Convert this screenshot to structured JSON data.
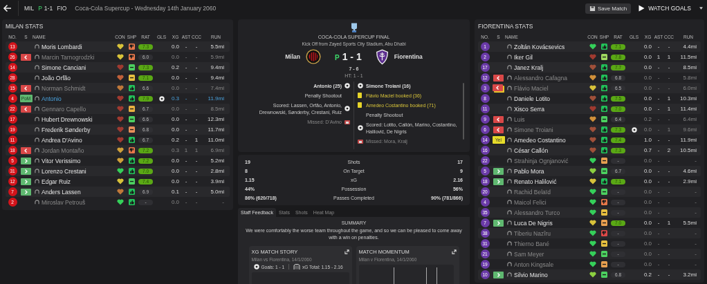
{
  "header": {
    "home": "MIL",
    "penalty_mark": "P",
    "score": "1-1",
    "away": "FIO",
    "title": "Coca-Cola Supercup - Wednesday 14th January 2060"
  },
  "actions": [
    {
      "kind": "save",
      "label": "Save Match"
    },
    {
      "kind": "watch",
      "label": "WATCH GOALS"
    }
  ],
  "teams": [
    {
      "title": "MILAN STATS",
      "color": "#d3141b",
      "columns": [
        "NO.",
        "S",
        "NAME",
        "CON",
        "SHP",
        "RAT",
        "GLS",
        "XG",
        "AST",
        "CCC",
        "RUN"
      ],
      "players": [
        {
          "no": "13",
          "name": "Moris Lombardi",
          "con": {
            "color": "#d8c23a"
          },
          "shp": {
            "kind": "down",
            "color": "#e8784a"
          },
          "rat": "7.3",
          "rat_high": true,
          "goal": false,
          "xg": "0.0",
          "ast": "-",
          "ccc": "-",
          "run": "5.5mi",
          "dimmed": false,
          "highlighted": false
        },
        {
          "no": "26",
          "sub": {
            "kind": "off"
          },
          "name": "Marcin Tarnogrodzki",
          "con": {
            "color": "#d8c23a"
          },
          "shp": {
            "kind": "down",
            "color": "#e8784a"
          },
          "rat": "6.0",
          "rat_high": false,
          "goal": false,
          "xg": "0.0",
          "ast": "-",
          "ccc": "-",
          "run": "5.9mi",
          "dimmed": true,
          "highlighted": false
        },
        {
          "no": "14",
          "name": "Simone Canciani",
          "con": {
            "color": "#a03a30"
          },
          "shp": {
            "kind": "level",
            "color": "#4cd060"
          },
          "rat": "7.3",
          "rat_high": true,
          "goal": false,
          "xg": "0.2",
          "ast": "-",
          "ccc": "-",
          "run": "9.4mi",
          "dimmed": false,
          "highlighted": false
        },
        {
          "no": "28",
          "name": "João Orfão",
          "con": {
            "color": "#c0603a"
          },
          "shp": {
            "kind": "level",
            "color": "#e8c040"
          },
          "rat": "7.1",
          "rat_high": true,
          "goal": false,
          "xg": "0.0",
          "ast": "-",
          "ccc": "-",
          "run": "9.4mi",
          "dimmed": false,
          "highlighted": false
        },
        {
          "no": "15",
          "sub": {
            "kind": "off"
          },
          "name": "Norman Schmidt",
          "con": {
            "color": "#c0783a"
          },
          "shp": {
            "kind": "up",
            "color": "#22c25a"
          },
          "rat": "6.6",
          "rat_high": false,
          "goal": false,
          "xg": "0.0",
          "ast": "-",
          "ccc": "-",
          "run": "7.4mi",
          "dimmed": true,
          "highlighted": false
        },
        {
          "no": "4",
          "sub": {
            "kind": "pom",
            "label": "PoM"
          },
          "name": "Antonio",
          "con": {
            "color": "#a03a30"
          },
          "shp": {
            "kind": "up",
            "color": "#22c25a"
          },
          "rat": "7.9",
          "rat_high": true,
          "goal": true,
          "xg": "0.3",
          "ast": "-",
          "ccc": "-",
          "run": "11.9mi",
          "dimmed": false,
          "highlighted": true
        },
        {
          "no": "22",
          "sub": {
            "kind": "off"
          },
          "name": "Gennaro Capello",
          "con": {
            "color": "#a03a30"
          },
          "shp": {
            "kind": "level",
            "color": "#e8b040"
          },
          "rat": "6.7",
          "rat_high": false,
          "goal": false,
          "xg": "0.0",
          "ast": "-",
          "ccc": "-",
          "run": "8.5mi",
          "dimmed": true,
          "highlighted": false
        },
        {
          "no": "17",
          "name": "Hubert Drewnowski",
          "con": {
            "color": "#a03a30"
          },
          "shp": {
            "kind": "level",
            "color": "#4cd060"
          },
          "rat": "6.6",
          "rat_high": false,
          "goal": false,
          "xg": "0.0",
          "ast": "-",
          "ccc": "-",
          "run": "12.3mi",
          "dimmed": false,
          "highlighted": false
        },
        {
          "no": "19",
          "name": "Frederik Sønderby",
          "con": {
            "color": "#a03a30"
          },
          "shp": {
            "kind": "level",
            "color": "#e8905a"
          },
          "rat": "6.8",
          "rat_high": false,
          "goal": false,
          "xg": "0.0",
          "ast": "-",
          "ccc": "-",
          "run": "11.7mi",
          "dimmed": false,
          "highlighted": false
        },
        {
          "no": "11",
          "name": "Andrea D'Avino",
          "con": {
            "color": "#a03a30"
          },
          "shp": {
            "kind": "up",
            "color": "#22c25a"
          },
          "rat": "6.7",
          "rat_high": false,
          "goal": false,
          "xg": "0.2",
          "ast": "-",
          "ccc": "1",
          "run": "11.0mi",
          "dimmed": false,
          "highlighted": false
        },
        {
          "no": "18",
          "sub": {
            "kind": "off"
          },
          "name": "Jordan Montaño",
          "con": {
            "color": "#d0a03a"
          },
          "shp": {
            "kind": "down",
            "color": "#e8784a"
          },
          "rat": "7.2",
          "rat_high": true,
          "goal": false,
          "xg": "0.3",
          "ast": "1",
          "ccc": "1",
          "run": "6.9mi",
          "dimmed": true,
          "highlighted": false
        },
        {
          "no": "5",
          "sub": {
            "kind": "on"
          },
          "name": "Vitor Verissimo",
          "con": {
            "color": "#d0a03a"
          },
          "shp": {
            "kind": "up",
            "color": "#22c25a"
          },
          "rat": "7.2",
          "rat_high": true,
          "goal": false,
          "xg": "0.0",
          "ast": "-",
          "ccc": "-",
          "run": "5.2mi",
          "dimmed": false,
          "highlighted": false
        },
        {
          "no": "31",
          "sub": {
            "kind": "on"
          },
          "name": "Lorenzo Crestani",
          "con": {
            "color": "#35d05a"
          },
          "shp": {
            "kind": "up",
            "color": "#22c25a"
          },
          "rat": "7.0",
          "rat_high": true,
          "goal": false,
          "xg": "0.0",
          "ast": "-",
          "ccc": "-",
          "run": "2.8mi",
          "dimmed": false,
          "highlighted": false
        },
        {
          "no": "12",
          "sub": {
            "kind": "on"
          },
          "name": "Edgar Ruiz",
          "con": {
            "color": "#d8c23a"
          },
          "shp": {
            "kind": "level",
            "color": "#4cd060"
          },
          "rat": "7.4",
          "rat_high": true,
          "goal": false,
          "xg": "0.0",
          "ast": "-",
          "ccc": "-",
          "run": "3.9mi",
          "dimmed": false,
          "highlighted": false
        },
        {
          "no": "7",
          "sub": {
            "kind": "on"
          },
          "name": "Anders Lassen",
          "con": {
            "color": "#c0783a"
          },
          "shp": {
            "kind": "up",
            "color": "#22c25a"
          },
          "rat": "6.9",
          "rat_high": false,
          "goal": false,
          "xg": "0.1",
          "ast": "-",
          "ccc": "-",
          "run": "5.0mi",
          "dimmed": false,
          "highlighted": false
        },
        {
          "no": "2",
          "name": "Miroslav Petrouš",
          "con": {
            "color": "#35d05a"
          },
          "shp": {
            "kind": "up",
            "color": "#22c25a"
          },
          "rat": "-",
          "rat_high": false,
          "goal": false,
          "xg": "0.0",
          "ast": "-",
          "ccc": "-",
          "run": "-",
          "dimmed": true,
          "highlighted": false
        }
      ]
    },
    {
      "title": "FIORENTINA STATS",
      "color": "#6a3aa8",
      "columns": [
        "NO.",
        "S",
        "NAME",
        "CON",
        "SHP",
        "RAT",
        "GLS",
        "XG",
        "AST",
        "CCC",
        "RUN"
      ],
      "players": [
        {
          "no": "1",
          "name": "Zoltán Kovácsevics",
          "con": {
            "color": "#35d05a"
          },
          "shp": {
            "kind": "up",
            "color": "#22c25a"
          },
          "rat": "7.1",
          "rat_high": true,
          "goal": false,
          "xg": "0.0",
          "ast": "-",
          "ccc": "-",
          "run": "4.4mi",
          "dimmed": false,
          "highlighted": false
        },
        {
          "no": "2",
          "name": "Iker Gil",
          "con": {
            "color": "#a03a30"
          },
          "shp": {
            "kind": "level",
            "color": "#a0d860"
          },
          "rat": "7.8",
          "rat_high": true,
          "goal": false,
          "xg": "0.0",
          "ast": "1",
          "ccc": "1",
          "run": "11.5mi",
          "dimmed": false,
          "highlighted": false
        },
        {
          "no": "17",
          "name": "Janez Kralj",
          "con": {
            "color": "#a0503a"
          },
          "shp": {
            "kind": "up",
            "color": "#22c25a"
          },
          "rat": "7.7",
          "rat_high": true,
          "goal": false,
          "xg": "0.0",
          "ast": "-",
          "ccc": "-",
          "run": "8.5mi",
          "dimmed": false,
          "highlighted": false
        },
        {
          "no": "12",
          "sub": {
            "kind": "off"
          },
          "name": "Alessandro Cafagna",
          "con": {
            "color": "#d0903a"
          },
          "shp": {
            "kind": "up",
            "color": "#22c25a"
          },
          "rat": "6.8",
          "rat_high": false,
          "goal": false,
          "xg": "0.0",
          "ast": "-",
          "ccc": "-",
          "run": "5.8mi",
          "dimmed": true,
          "highlighted": false
        },
        {
          "no": "3",
          "sub": {
            "kind": "off_booked"
          },
          "name": "Flávio Maciel",
          "con": {
            "color": "#d8c23a"
          },
          "shp": {
            "kind": "up",
            "color": "#22c25a"
          },
          "rat": "6.5",
          "rat_high": false,
          "goal": false,
          "xg": "0.0",
          "ast": "-",
          "ccc": "-",
          "run": "6.0mi",
          "dimmed": true,
          "highlighted": false
        },
        {
          "no": "8",
          "name": "Daniele Lotito",
          "con": {
            "color": "#a0503a"
          },
          "shp": {
            "kind": "up",
            "color": "#22c25a"
          },
          "rat": "7.5",
          "rat_high": true,
          "goal": false,
          "xg": "0.0",
          "ast": "-",
          "ccc": "1",
          "run": "10.3mi",
          "dimmed": false,
          "highlighted": false
        },
        {
          "no": "11",
          "name": "Xisco Serra",
          "con": {
            "color": "#a03a30"
          },
          "shp": {
            "kind": "up",
            "color": "#22c25a"
          },
          "rat": "7.0",
          "rat_high": true,
          "goal": false,
          "xg": "0.0",
          "ast": "-",
          "ccc": "1",
          "run": "11.4mi",
          "dimmed": false,
          "highlighted": false
        },
        {
          "no": "9",
          "sub": {
            "kind": "off"
          },
          "name": "Luis",
          "con": {
            "color": "#d0903a"
          },
          "shp": {
            "kind": "level",
            "color": "#4cd060"
          },
          "rat": "6.4",
          "rat_high": false,
          "goal": false,
          "xg": "0.2",
          "ast": "-",
          "ccc": "-",
          "run": "6.4mi",
          "dimmed": true,
          "highlighted": false
        },
        {
          "no": "6",
          "sub": {
            "kind": "off"
          },
          "name": "Simone Troiani",
          "con": {
            "color": "#a0503a"
          },
          "shp": {
            "kind": "up",
            "color": "#22c25a"
          },
          "rat": "7.3",
          "rat_high": true,
          "goal": true,
          "xg": "0.0",
          "ast": "-",
          "ccc": "1",
          "run": "9.6mi",
          "dimmed": true,
          "highlighted": false
        },
        {
          "no": "14",
          "sub": {
            "kind": "booked",
            "label": "Yel"
          },
          "name": "Amedeo Costantino",
          "con": {
            "color": "#a0503a"
          },
          "shp": {
            "kind": "up",
            "color": "#22c25a"
          },
          "rat": "7.4",
          "rat_high": true,
          "goal": false,
          "xg": "1.0",
          "ast": "-",
          "ccc": "-",
          "run": "11.9mi",
          "dimmed": false,
          "highlighted": false
        },
        {
          "no": "16",
          "name": "César Callón",
          "con": {
            "color": "#a0503a"
          },
          "shp": {
            "kind": "up",
            "color": "#22c25a"
          },
          "rat": "7.3",
          "rat_high": true,
          "goal": false,
          "xg": "0.7",
          "ast": "-",
          "ccc": "2",
          "run": "10.5mi",
          "dimmed": false,
          "highlighted": false
        },
        {
          "no": "22",
          "name": "Strahinja Ognjanović",
          "con": {
            "color": "#35d05a"
          },
          "shp": {
            "kind": "level",
            "color": "#e8a050"
          },
          "rat": "-",
          "rat_high": false,
          "goal": false,
          "xg": "0.0",
          "ast": "-",
          "ccc": "-",
          "run": "-",
          "dimmed": true,
          "highlighted": false
        },
        {
          "no": "5",
          "sub": {
            "kind": "on"
          },
          "name": "Pablo Mora",
          "con": {
            "color": "#8cd040"
          },
          "shp": {
            "kind": "level",
            "color": "#4cd060"
          },
          "rat": "6.7",
          "rat_high": false,
          "goal": false,
          "xg": "0.0",
          "ast": "-",
          "ccc": "-",
          "run": "4.6mi",
          "dimmed": false,
          "highlighted": false
        },
        {
          "no": "18",
          "sub": {
            "kind": "on"
          },
          "name": "Renato Halilović",
          "con": {
            "color": "#d8c23a"
          },
          "shp": {
            "kind": "up",
            "color": "#22c25a"
          },
          "rat": "7.1",
          "rat_high": true,
          "goal": false,
          "xg": "0.0",
          "ast": "-",
          "ccc": "-",
          "run": "2.9mi",
          "dimmed": false,
          "highlighted": false
        },
        {
          "no": "20",
          "name": "Rachid Belaïd",
          "con": {
            "color": "#35d05a"
          },
          "shp": {
            "kind": "level",
            "color": "#4cd060"
          },
          "rat": "-",
          "rat_high": false,
          "goal": false,
          "xg": "0.0",
          "ast": "-",
          "ccc": "-",
          "run": "-",
          "dimmed": true,
          "highlighted": false
        },
        {
          "no": "4",
          "name": "Maicol Felici",
          "con": {
            "color": "#35d05a"
          },
          "shp": {
            "kind": "down",
            "color": "#e8784a"
          },
          "rat": "-",
          "rat_high": false,
          "goal": false,
          "xg": "0.0",
          "ast": "-",
          "ccc": "-",
          "run": "-",
          "dimmed": true,
          "highlighted": false
        },
        {
          "no": "35",
          "name": "Alessandro Turco",
          "con": {
            "color": "#35d05a"
          },
          "shp": {
            "kind": "level",
            "color": "#e8c040"
          },
          "rat": "-",
          "rat_high": false,
          "goal": false,
          "xg": "0.0",
          "ast": "-",
          "ccc": "-",
          "run": "-",
          "dimmed": true,
          "highlighted": false
        },
        {
          "no": "7",
          "sub": {
            "kind": "on"
          },
          "name": "Luca De Nigris",
          "con": {
            "color": "#d8c23a"
          },
          "shp": {
            "kind": "level",
            "color": "#e8a050"
          },
          "rat": "7.0",
          "rat_high": true,
          "goal": false,
          "xg": "0.0",
          "ast": "-",
          "ccc": "1",
          "run": "5.5mi",
          "dimmed": false,
          "highlighted": false
        },
        {
          "no": "38",
          "name": "Tiberiu Nazîru",
          "con": {
            "color": "#35d05a"
          },
          "shp": {
            "kind": "down",
            "color": "#e04848"
          },
          "rat": "-",
          "rat_high": false,
          "goal": false,
          "xg": "0.0",
          "ast": "-",
          "ccc": "-",
          "run": "-",
          "dimmed": true,
          "highlighted": false
        },
        {
          "no": "31",
          "name": "Thierno Bané",
          "con": {
            "color": "#35d05a"
          },
          "shp": {
            "kind": "level",
            "color": "#e8c040"
          },
          "rat": "-",
          "rat_high": false,
          "goal": false,
          "xg": "0.0",
          "ast": "-",
          "ccc": "-",
          "run": "-",
          "dimmed": true,
          "highlighted": false
        },
        {
          "no": "21",
          "name": "Sam Meyer",
          "con": {
            "color": "#35d05a"
          },
          "shp": {
            "kind": "level",
            "color": "#4cd060"
          },
          "rat": "-",
          "rat_high": false,
          "goal": false,
          "xg": "0.0",
          "ast": "-",
          "ccc": "-",
          "run": "-",
          "dimmed": true,
          "highlighted": false
        },
        {
          "no": "19",
          "name": "Anton Kingsale",
          "con": {
            "color": "#35d05a"
          },
          "shp": {
            "kind": "level",
            "color": "#e8a050"
          },
          "rat": "-",
          "rat_high": false,
          "goal": false,
          "xg": "0.0",
          "ast": "-",
          "ccc": "-",
          "run": "-",
          "dimmed": true,
          "highlighted": false
        },
        {
          "no": "10",
          "sub": {
            "kind": "on"
          },
          "name": "Silvio Marino",
          "con": {
            "color": "#8cd040"
          },
          "shp": {
            "kind": "level",
            "color": "#4cd060"
          },
          "rat": "6.8",
          "rat_high": false,
          "goal": false,
          "xg": "0.2",
          "ast": "-",
          "ccc": "-",
          "run": "3.2mi",
          "dimmed": false,
          "highlighted": false
        }
      ]
    }
  ],
  "match": {
    "competition": "COCA-COLA SUPERCUP FINAL",
    "venue": "Kick Off from Zayed Sports City Stadium, Abu Dhabi",
    "home": "Milan",
    "away": "Fiorentina",
    "penalty_mark": "P",
    "score": "1 - 1",
    "penalties": "7 - 6",
    "half_time": "HT: 1 - 1",
    "home_events": [
      {
        "kind": "goal",
        "text": "Antonio (25)"
      },
      {
        "kind": "heading",
        "text": "Penalty Shootout"
      },
      {
        "kind": "scored",
        "text": "Scored: Lassen, Orfão, Antonio, Drewnowski, Sønderby, Crestani, Ruiz"
      },
      {
        "kind": "missed",
        "text": "Missed: D'Avino"
      }
    ],
    "away_events": [
      {
        "kind": "goal",
        "text": "Simone Troiani (16)"
      },
      {
        "kind": "booking",
        "text": "Flávio Maciel booked (36)"
      },
      {
        "kind": "booking",
        "text": "Amedeo Costantino booked (71)"
      },
      {
        "kind": "heading",
        "text": "Penalty Shootout"
      },
      {
        "kind": "scored",
        "text": "Scored: Lotito, Callón, Marino, Costantino, Halilović, De Nigris"
      },
      {
        "kind": "missed",
        "text": "Missed: Mora, Kralj"
      }
    ]
  },
  "stats": [
    {
      "home": "19",
      "label": "Shots",
      "away": "17"
    },
    {
      "home": "8",
      "label": "On Target",
      "away": "9"
    },
    {
      "home": "1.15",
      "label": "xG",
      "away": "2.16"
    },
    {
      "home": "44%",
      "label": "Possession",
      "away": "56%"
    },
    {
      "home": "86% (620/718)",
      "label": "Passes Completed",
      "away": "90% (781/866)"
    }
  ],
  "tabs": [
    {
      "label": "Staff Feedback",
      "selected": true
    },
    {
      "label": "Stats",
      "selected": false
    },
    {
      "label": "Shots",
      "selected": false
    },
    {
      "label": "Heat Map",
      "selected": false
    }
  ],
  "feedback": {
    "heading": "SUMMARY",
    "text": "We were comfortably the worse team throughout the game, and so we can be pleased to come away with a win on penalties."
  },
  "cards": [
    {
      "kind": "xg",
      "title": "XG MATCH STORY",
      "subtitle": "Milan vs Fiorentina, 14/1/2060",
      "goals": "Goals: 1 - 1",
      "xg_total": "xG Total: 1.15 - 2.16"
    },
    {
      "kind": "momentum",
      "title": "MATCH MOMENTUM",
      "subtitle": "Milan v Fiorentina, 14/1/2060"
    }
  ]
}
